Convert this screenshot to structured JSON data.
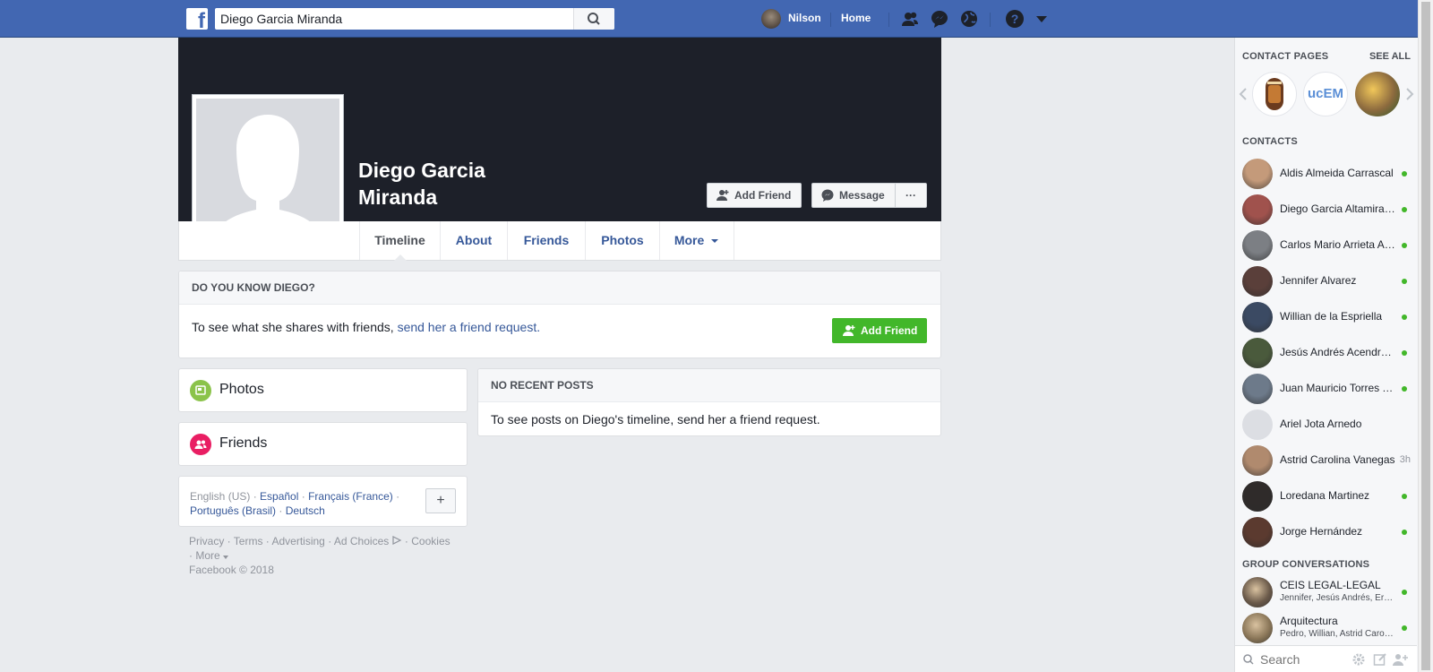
{
  "topbar": {
    "logo_letter": "f",
    "search_value": "Diego Garcia Miranda",
    "user_name": "Nilson",
    "home_label": "Home"
  },
  "profile": {
    "name": "Diego Garcia Miranda",
    "add_friend_label": "Add Friend",
    "message_label": "Message",
    "more_label": "···",
    "tabs": [
      {
        "label": "Timeline"
      },
      {
        "label": "About"
      },
      {
        "label": "Friends"
      },
      {
        "label": "Photos"
      },
      {
        "label": "More"
      }
    ]
  },
  "know_card": {
    "title": "DO YOU KNOW DIEGO?",
    "text": "To see what she shares with friends, ",
    "link": "send her a friend request.",
    "button": "Add Friend"
  },
  "photos_card": {
    "title": "Photos"
  },
  "friends_card": {
    "title": "Friends"
  },
  "posts_card": {
    "title": "NO RECENT POSTS",
    "text": "To see posts on Diego's timeline, send her a friend request."
  },
  "languages": {
    "current": "English (US)",
    "items": [
      "Español",
      "Français (France)",
      "Português (Brasil)",
      "Deutsch"
    ],
    "sep": " · ",
    "plus": "+"
  },
  "footer": {
    "links": [
      "Privacy",
      "Terms",
      "Advertising",
      "Ad Choices",
      "Cookies",
      "More"
    ],
    "sep": " · ",
    "copyright": "Facebook © 2018"
  },
  "sidebar": {
    "contact_pages_title": "CONTACT PAGES",
    "see_all": "SEE ALL",
    "pages_logo_text": "ucEM",
    "contacts_title": "CONTACTS",
    "contacts": [
      {
        "name": "Aldis Almeida Carrascal",
        "status": "online",
        "color": "#c49a7a"
      },
      {
        "name": "Diego Garcia Altamiranda",
        "status": "online",
        "color": "#a0524d"
      },
      {
        "name": "Carlos Mario Arrieta Arrieta",
        "status": "online",
        "color": "#7c7f84"
      },
      {
        "name": "Jennifer Alvarez",
        "status": "online",
        "color": "#5a3f3a"
      },
      {
        "name": "Willian de la Espriella",
        "status": "online",
        "color": "#3b4a63"
      },
      {
        "name": "Jesús Andrés Acendra Arrieta",
        "status": "online",
        "color": "#4a5a3c"
      },
      {
        "name": "Juan Mauricio Torres Torres",
        "status": "online",
        "color": "#6d7a8a"
      },
      {
        "name": "Ariel Jota Arnedo",
        "status": "none",
        "color": "#dcdee3"
      },
      {
        "name": "Astrid Carolina Vanegas",
        "status": "3h",
        "color": "#b08a6e"
      },
      {
        "name": "Loredana Martinez",
        "status": "online",
        "color": "#2f2b2a"
      },
      {
        "name": "Jorge Hernández",
        "status": "online",
        "color": "#5b3a2f"
      }
    ],
    "groups_title": "GROUP CONVERSATIONS",
    "groups": [
      {
        "name": "CEIS LEGAL-LEGAL",
        "members": "Jennifer, Jesús Andrés, Ernesto",
        "color": "#6b5a4a"
      },
      {
        "name": "Arquitectura",
        "members": "Pedro, Willian, Astrid Carolina",
        "color": "#8a7658"
      }
    ],
    "search_placeholder": "Search"
  },
  "colors": {
    "brand": "#4267b2",
    "cover": "#1d2029",
    "online": "#42b72a",
    "link": "#365899"
  }
}
